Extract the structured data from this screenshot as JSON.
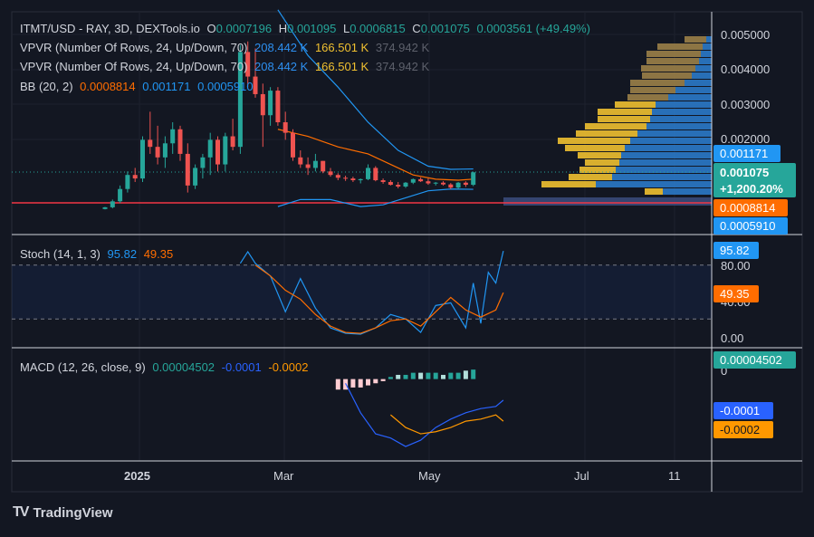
{
  "header": {
    "symbol": "ITMT/USD - RAY, 3D, DEXTools.io",
    "o_label": "O",
    "o": "0.0007196",
    "h_label": "H",
    "h": "0.001095",
    "l_label": "L",
    "l": "0.0006815",
    "c_label": "C",
    "c": "0.001075",
    "change": "0.0003561 (+49.49%)"
  },
  "legends": {
    "vpvr1": {
      "label": "VPVR (Number Of Rows, 24, Up/Down, 70)",
      "up": "208.442 K",
      "down": "166.501 K",
      "total": "374.942 K"
    },
    "vpvr2": {
      "label": "VPVR (Number Of Rows, 24, Up/Down, 70)",
      "up": "208.442 K",
      "down": "166.501 K",
      "total": "374.942 K"
    },
    "bb": {
      "label": "BB (20, 2)",
      "basis": "0.0008814",
      "upper": "0.001171",
      "lower": "0.0005910"
    },
    "stoch": {
      "label": "Stoch (14, 1, 3)",
      "k": "95.82",
      "d": "49.35"
    },
    "macd": {
      "label": "MACD (12, 26, close, 9)",
      "hist": "0.00004502",
      "macd": "-0.0001",
      "signal": "-0.0002"
    }
  },
  "price_axis": [
    "0.005000",
    "0.004000",
    "0.003000",
    "0.002000"
  ],
  "price_badges": {
    "upper": "0.001171",
    "last": "0.001075",
    "pct": "+1,200.20%",
    "basis": "0.0008814",
    "lower": "0.0005910"
  },
  "stoch_axis": [
    "80.00",
    "40.00",
    "0.00"
  ],
  "stoch_badges": {
    "k": "95.82",
    "d": "49.35"
  },
  "macd_axis": [
    "0"
  ],
  "macd_badges": {
    "hist": "0.00004502",
    "macd": "-0.0001",
    "signal": "-0.0002"
  },
  "time_axis": [
    "2025",
    "Mar",
    "May",
    "Jul",
    "11"
  ],
  "brand": "TradingView",
  "colors": {
    "bg": "#131722",
    "up": "#26a69a",
    "down": "#ef5350",
    "basis": "#ff6d00",
    "band": "#2196f3",
    "stoch_k": "#2196f3",
    "stoch_d": "#ff6d00",
    "macd": "#2962ff",
    "signal": "#ff9800",
    "vp_up": "#2d7fd1",
    "vp_down": "#f0c030",
    "support": "#f23645"
  },
  "chart_data": [
    {
      "type": "candlestick",
      "title": "ITMT/USD - RAY, 3D, DEXTools.io",
      "ylim": [
        0.00015,
        0.0054
      ],
      "x_labels": [
        "2025",
        "Mar",
        "May",
        "Jul",
        "11"
      ],
      "candles": [
        [
          3e-05,
          9e-05,
          2e-05,
          8e-05
        ],
        [
          8e-05,
          0.0003,
          5e-05,
          0.00025
        ],
        [
          0.00025,
          0.0007,
          0.0002,
          0.0006
        ],
        [
          0.0006,
          0.0011,
          0.0005,
          0.001
        ],
        [
          0.001,
          0.0012,
          0.0008,
          0.0009
        ],
        [
          0.0009,
          0.0021,
          0.0008,
          0.002
        ],
        [
          0.002,
          0.0028,
          0.0016,
          0.0018
        ],
        [
          0.0018,
          0.0024,
          0.0013,
          0.0015
        ],
        [
          0.0015,
          0.0021,
          0.0012,
          0.0019
        ],
        [
          0.0019,
          0.0025,
          0.0016,
          0.0023
        ],
        [
          0.0023,
          0.0024,
          0.0014,
          0.0016
        ],
        [
          0.0016,
          0.0019,
          0.0005,
          0.0007
        ],
        [
          0.0007,
          0.0013,
          0.0006,
          0.0012
        ],
        [
          0.0012,
          0.0016,
          0.0009,
          0.0015
        ],
        [
          0.0015,
          0.0022,
          0.001,
          0.002
        ],
        [
          0.002,
          0.0021,
          0.0011,
          0.0013
        ],
        [
          0.0013,
          0.0022,
          0.0011,
          0.0021
        ],
        [
          0.0021,
          0.0026,
          0.0017,
          0.0018
        ],
        [
          0.0018,
          0.0047,
          0.0016,
          0.0045
        ],
        [
          0.0045,
          0.0048,
          0.0035,
          0.0038
        ],
        [
          0.0038,
          0.0046,
          0.0032,
          0.0033
        ],
        [
          0.0033,
          0.0036,
          0.0018,
          0.0027
        ],
        [
          0.0027,
          0.0035,
          0.0024,
          0.0034
        ],
        [
          0.0034,
          0.0035,
          0.0024,
          0.0025
        ],
        [
          0.0025,
          0.0028,
          0.002,
          0.0022
        ],
        [
          0.0022,
          0.0023,
          0.0014,
          0.0015
        ],
        [
          0.0015,
          0.0017,
          0.0012,
          0.0013
        ],
        [
          0.0013,
          0.0015,
          0.001,
          0.0012
        ],
        [
          0.0012,
          0.0016,
          0.0011,
          0.0014
        ],
        [
          0.0014,
          0.0014,
          0.00105,
          0.0011
        ],
        [
          0.0011,
          0.0012,
          0.00095,
          0.001
        ],
        [
          0.001,
          0.00105,
          0.00085,
          0.00092
        ],
        [
          0.00092,
          0.00098,
          0.00083,
          0.0009
        ],
        [
          0.0009,
          0.00095,
          0.0008,
          0.00085
        ],
        [
          0.00085,
          0.0009,
          0.00076,
          0.00088
        ],
        [
          0.00088,
          0.0013,
          0.00085,
          0.0012
        ],
        [
          0.0012,
          0.00125,
          0.00082,
          0.00085
        ],
        [
          0.00085,
          0.0009,
          0.00075,
          0.0008
        ],
        [
          0.0008,
          0.00085,
          0.0007,
          0.00072
        ],
        [
          0.00072,
          0.0008,
          0.00062,
          0.00067
        ],
        [
          0.00067,
          0.0008,
          0.00063,
          0.00078
        ],
        [
          0.00078,
          0.0009,
          0.00074,
          0.00088
        ],
        [
          0.00088,
          0.00093,
          0.0008,
          0.00082
        ],
        [
          0.00082,
          0.0009,
          0.00072,
          0.00076
        ],
        [
          0.00076,
          0.0008,
          0.0007,
          0.00078
        ],
        [
          0.00078,
          0.00082,
          0.0007,
          0.00073
        ],
        [
          0.00073,
          0.00077,
          0.0006,
          0.00064
        ],
        [
          0.00064,
          0.0008,
          0.0006,
          0.00078
        ],
        [
          0.00078,
          0.00082,
          0.00066,
          0.00072
        ],
        [
          0.0007196,
          0.001095,
          0.0006815,
          0.001075
        ]
      ],
      "bb_upper": [
        [
          23,
          0.0057
        ],
        [
          27,
          0.0044
        ],
        [
          31,
          0.0035
        ],
        [
          35,
          0.0025
        ],
        [
          39,
          0.0017
        ],
        [
          43,
          0.00125
        ],
        [
          46,
          0.00116
        ],
        [
          49,
          0.001171
        ]
      ],
      "bb_basis": [
        [
          23,
          0.0023
        ],
        [
          27,
          0.0021
        ],
        [
          31,
          0.0018
        ],
        [
          35,
          0.0016
        ],
        [
          38,
          0.0013
        ],
        [
          41,
          0.001
        ],
        [
          44,
          0.00088
        ],
        [
          47,
          0.00085
        ],
        [
          49,
          0.0008814
        ]
      ],
      "bb_lower": [
        [
          23,
          0.0001
        ],
        [
          26,
          0.0003
        ],
        [
          30,
          0.0003
        ],
        [
          34,
          0.0001
        ],
        [
          37,
          0.00015
        ],
        [
          40,
          0.00035
        ],
        [
          43,
          0.00055
        ],
        [
          46,
          0.0006
        ],
        [
          49,
          0.000591
        ]
      ],
      "support_level": 0.00022
    },
    {
      "type": "line",
      "title": "Stoch (14, 1, 3)",
      "ylim": [
        0,
        100
      ],
      "bands": [
        20,
        80
      ],
      "series": [
        {
          "name": "K",
          "points": [
            [
              18,
              82
            ],
            [
              19,
              95
            ],
            [
              20,
              82
            ],
            [
              22,
              68
            ],
            [
              24,
              28
            ],
            [
              26,
              65
            ],
            [
              28,
              32
            ],
            [
              30,
              10
            ],
            [
              32,
              4
            ],
            [
              34,
              3
            ],
            [
              36,
              10
            ],
            [
              38,
              25
            ],
            [
              40,
              20
            ],
            [
              42,
              5
            ],
            [
              44,
              35
            ],
            [
              46,
              38
            ],
            [
              48,
              10
            ],
            [
              49,
              60
            ],
            [
              50,
              15
            ],
            [
              51,
              72
            ],
            [
              52,
              60
            ],
            [
              53,
              95.82
            ]
          ]
        },
        {
          "name": "D",
          "points": [
            [
              20,
              80
            ],
            [
              22,
              68
            ],
            [
              24,
              52
            ],
            [
              26,
              42
            ],
            [
              28,
              25
            ],
            [
              30,
              12
            ],
            [
              32,
              5
            ],
            [
              34,
              4
            ],
            [
              36,
              10
            ],
            [
              38,
              18
            ],
            [
              40,
              20
            ],
            [
              42,
              12
            ],
            [
              44,
              28
            ],
            [
              46,
              44
            ],
            [
              48,
              30
            ],
            [
              50,
              22
            ],
            [
              52,
              30
            ],
            [
              53,
              49.35
            ]
          ]
        }
      ]
    },
    {
      "type": "line",
      "title": "MACD (12, 26, close, 9)",
      "ylim": [
        -0.0004,
        0.0001
      ],
      "histogram": [
        -5e-05,
        -5e-05,
        -4e-05,
        -4e-05,
        -3e-05,
        -2e-05,
        -1e-05,
        1e-05,
        2e-05,
        2e-05,
        3e-05,
        3e-05,
        3e-05,
        3e-05,
        2e-05,
        3e-05,
        3e-05,
        4e-05,
        4.502e-05
      ],
      "series": [
        {
          "name": "MACD",
          "points": [
            [
              32,
              -2e-05
            ],
            [
              34,
              -0.00016
            ],
            [
              36,
              -0.00026
            ],
            [
              38,
              -0.00028
            ],
            [
              40,
              -0.00032
            ],
            [
              42,
              -0.00029
            ],
            [
              44,
              -0.00023
            ],
            [
              46,
              -0.00019
            ],
            [
              48,
              -0.00016
            ],
            [
              50,
              -0.00014
            ],
            [
              52,
              -0.00013
            ],
            [
              53,
              -0.0001
            ]
          ]
        },
        {
          "name": "Signal",
          "points": [
            [
              38,
              -0.00017
            ],
            [
              40,
              -0.00023
            ],
            [
              42,
              -0.00026
            ],
            [
              44,
              -0.00025
            ],
            [
              46,
              -0.00023
            ],
            [
              48,
              -0.0002
            ],
            [
              50,
              -0.00019
            ],
            [
              52,
              -0.00017
            ],
            [
              53,
              -0.0002
            ]
          ]
        }
      ]
    }
  ]
}
